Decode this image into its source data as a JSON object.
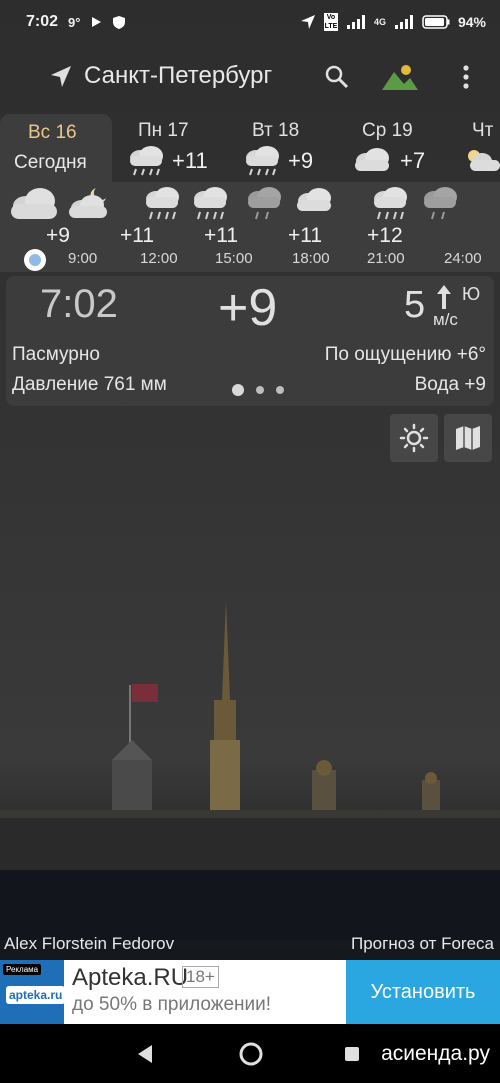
{
  "status_bar": {
    "time": "7:02",
    "temp_badge": "9°",
    "battery": "94%",
    "volte": "Vo LTE",
    "network": "4G"
  },
  "app_bar": {
    "city": "Санкт-Петербург"
  },
  "days": [
    {
      "name": "Вс 16",
      "sub": "Сегодня",
      "temp": "",
      "icon": "cloud-icon",
      "selected": true
    },
    {
      "name": "Пн 17",
      "sub": "",
      "temp": "+11",
      "icon": "rain-icon",
      "selected": false
    },
    {
      "name": "Вт 18",
      "sub": "",
      "temp": "+9",
      "icon": "rain-icon",
      "selected": false
    },
    {
      "name": "Ср 19",
      "sub": "",
      "temp": "+7",
      "icon": "cloud-icon",
      "selected": false
    },
    {
      "name": "Чт",
      "sub": "",
      "temp": "",
      "icon": "partly-cloudy-icon",
      "selected": false
    }
  ],
  "hourly": {
    "temps": [
      "+9",
      "+11",
      "+11",
      "+11",
      "+12"
    ],
    "times": [
      "9:00",
      "12:00",
      "15:00",
      "18:00",
      "21:00",
      "24:00"
    ]
  },
  "current": {
    "time": "7:02",
    "temp": "+9",
    "wind_speed": "5",
    "wind_dir": "Ю",
    "wind_unit": "м/с",
    "condition": "Пасмурно",
    "feels_like": "По ощущению +6°",
    "pressure": "Давление 761 мм",
    "water": "Вода +9"
  },
  "credits": {
    "photo_author": "Alex Florstein Fedorov",
    "forecast_source": "Прогноз от Foreca"
  },
  "ad": {
    "badge": "Реклама",
    "logo_text": "apteka.ru",
    "title": "Apteka.RU",
    "age": "18+",
    "subtitle": "до 50% в приложении!",
    "button": "Установить"
  },
  "watermark": "асиенда.ру",
  "colors": {
    "accent_day": "#e8c98a",
    "ad_button": "#2aa6e0",
    "now_dot": "#8fb9e6"
  }
}
